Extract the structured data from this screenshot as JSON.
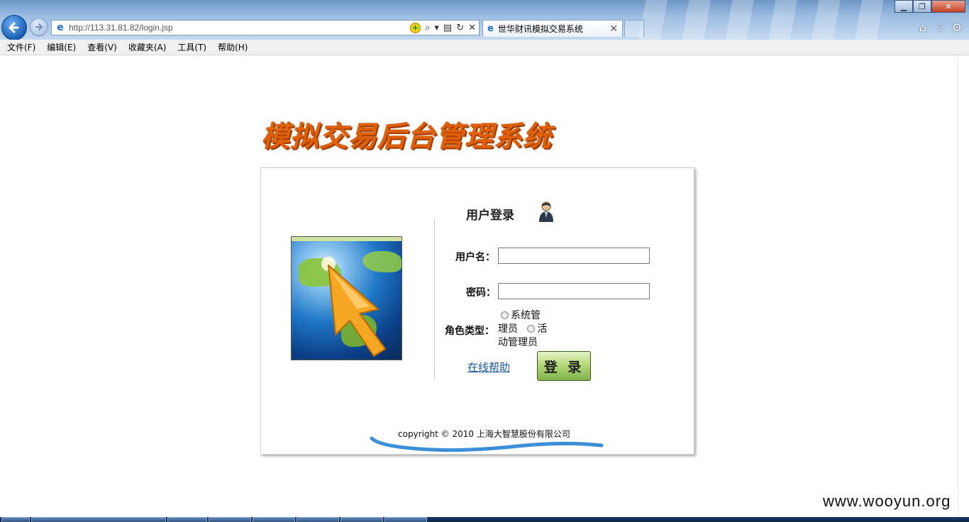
{
  "browser": {
    "address_url": "http://113.31.81.82/login.jsp",
    "tab_title": "世华财讯模拟交易系统",
    "menu": [
      "文件(F)",
      "编辑(E)",
      "查看(V)",
      "收藏夹(A)",
      "工具(T)",
      "帮助(H)"
    ]
  },
  "page": {
    "system_title": "模拟交易后台管理系统",
    "login_heading": "用户登录",
    "username_label": "用户名：",
    "password_label": "密码：",
    "role_label": "角色类型：",
    "roles": {
      "line1": "系统管",
      "line2": "理员",
      "line2b": "活",
      "line3": "动管理员"
    },
    "online_help": "在线帮助",
    "login_button": "登 录",
    "copyright": "copyright © 2010 上海大智慧股份有限公司"
  },
  "watermark": "www.wooyun.org",
  "colors": {
    "title_orange": "#e0600a",
    "link_blue": "#1a5a9a",
    "button_green": "#7fb24a",
    "annotation_blue": "#3a8fd8"
  }
}
